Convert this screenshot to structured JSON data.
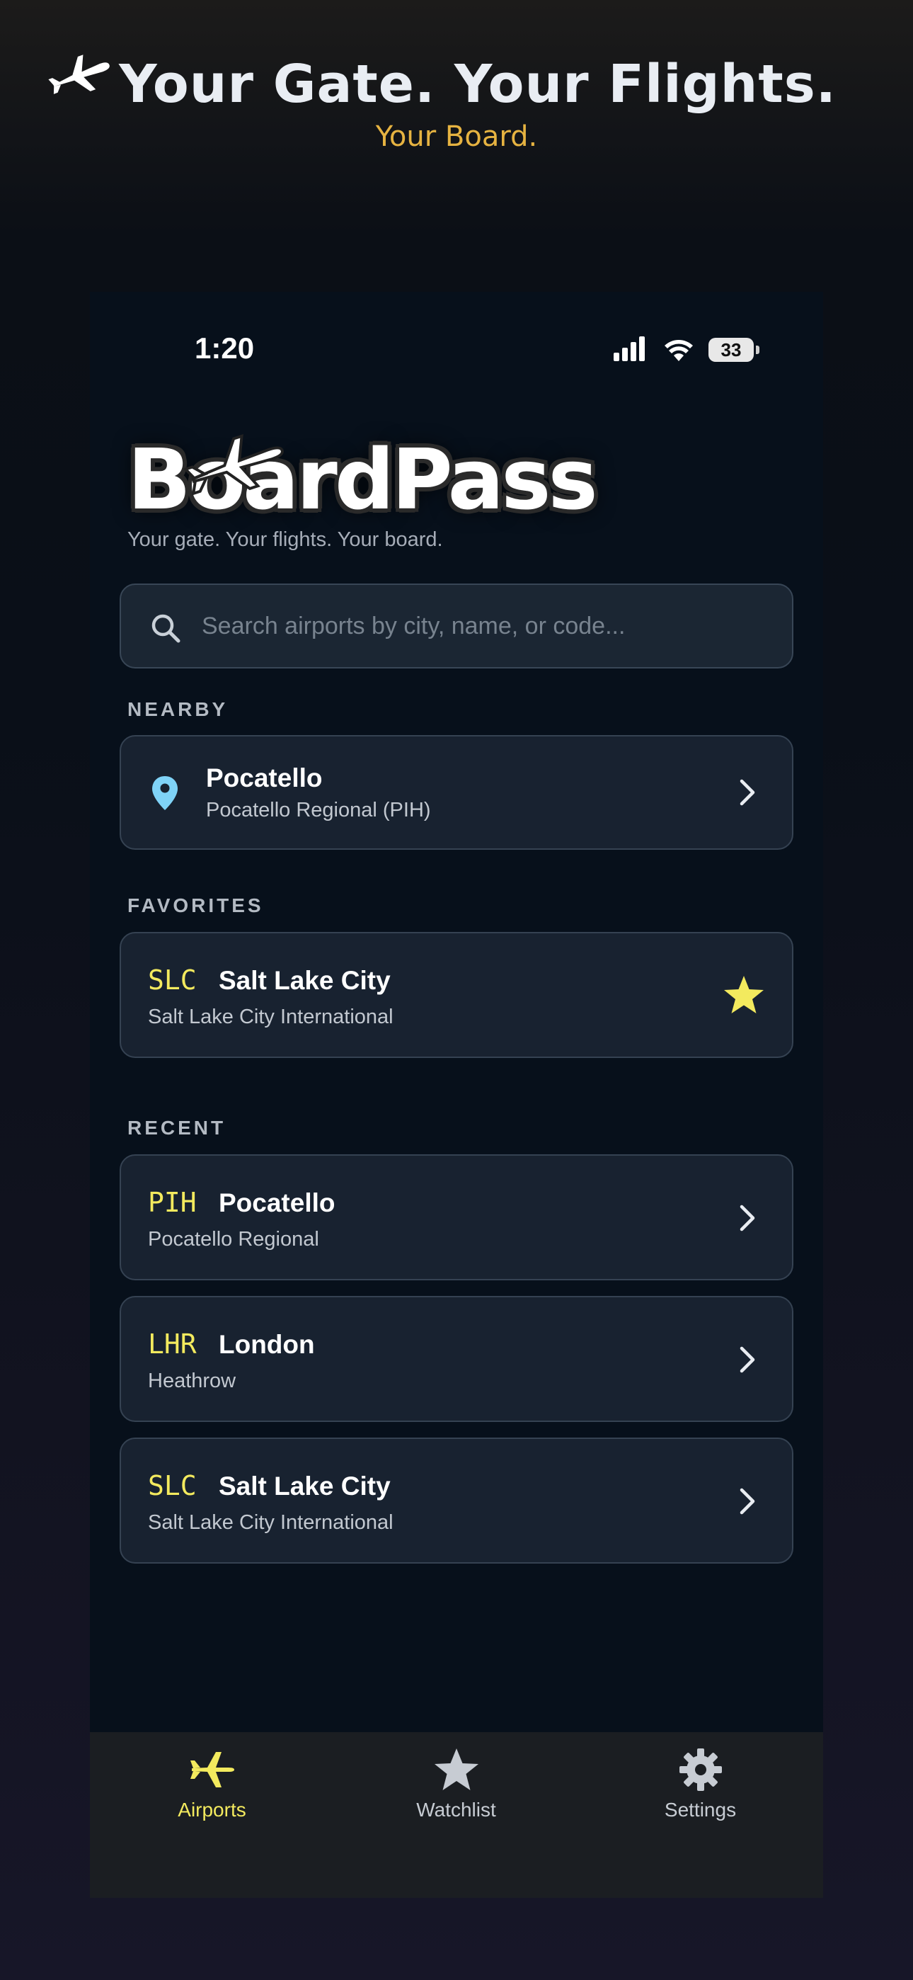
{
  "hero": {
    "title": "Your Gate. Your Flights.",
    "subtitle": "Your Board."
  },
  "status_bar": {
    "time": "1:20",
    "battery": "33"
  },
  "app": {
    "logo_text": "BoardPass",
    "tagline": "Your gate. Your flights. Your board."
  },
  "search": {
    "placeholder": "Search airports by city, name, or code..."
  },
  "nearby": {
    "label": "NEARBY",
    "items": [
      {
        "title": "Pocatello",
        "subtitle": "Pocatello Regional (PIH)"
      }
    ]
  },
  "favorites": {
    "label": "FAVORITES",
    "items": [
      {
        "code": "SLC",
        "title": "Salt Lake City",
        "subtitle": "Salt Lake City International"
      }
    ]
  },
  "recent": {
    "label": "RECENT",
    "items": [
      {
        "code": "PIH",
        "title": "Pocatello",
        "subtitle": "Pocatello Regional"
      },
      {
        "code": "LHR",
        "title": "London",
        "subtitle": "Heathrow"
      },
      {
        "code": "SLC",
        "title": "Salt Lake City",
        "subtitle": "Salt Lake City International"
      }
    ]
  },
  "tabbar": {
    "tabs": [
      {
        "label": "Airports",
        "icon": "airplane-icon",
        "active": true
      },
      {
        "label": "Watchlist",
        "icon": "star-icon",
        "active": false
      },
      {
        "label": "Settings",
        "icon": "gear-icon",
        "active": false
      }
    ]
  },
  "colors": {
    "accent_yellow": "#f3ea5e",
    "hero_gold": "#e6b341",
    "pin_blue": "#7fd3f7",
    "inactive_tab": "#c7ccd3"
  }
}
